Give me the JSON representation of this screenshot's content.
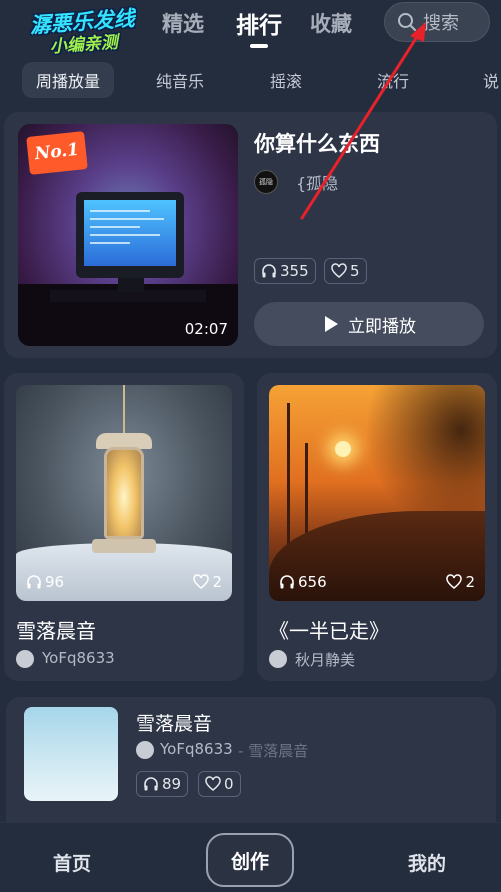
{
  "watermark": {
    "line1": "潺悪乐发线",
    "line2": "小编亲测"
  },
  "header": {
    "tabs": [
      {
        "label": "精选",
        "active": false
      },
      {
        "label": "排行",
        "active": true
      },
      {
        "label": "收藏",
        "active": false
      }
    ],
    "search_placeholder": "搜索"
  },
  "subtabs": [
    "周播放量",
    "纯音乐",
    "摇滚",
    "流行",
    "说"
  ],
  "featured": {
    "rank_badge": "No.1",
    "title": "你算什么东西",
    "artist": "{孤隐",
    "avatar_text": "孤隐",
    "duration": "02:07",
    "plays": "355",
    "likes": "5",
    "play_label": "立即播放"
  },
  "grid": [
    {
      "title": "雪落晨音",
      "author": "YoFq8633",
      "plays": "96",
      "likes": "2"
    },
    {
      "title": "《一半已走》",
      "author": "秋月静美",
      "plays": "656",
      "likes": "2"
    }
  ],
  "list": [
    {
      "title": "雪落晨音",
      "author": "YoFq8633",
      "album": "雪落晨音",
      "plays": "89",
      "likes": "0"
    }
  ],
  "bottom_nav": {
    "home": "首页",
    "create": "创作",
    "mine": "我的"
  },
  "colors": {
    "background": "#242d3e",
    "card": "#2d3547",
    "annotation_arrow": "#e8212a",
    "badge": "#ff5b2a"
  }
}
